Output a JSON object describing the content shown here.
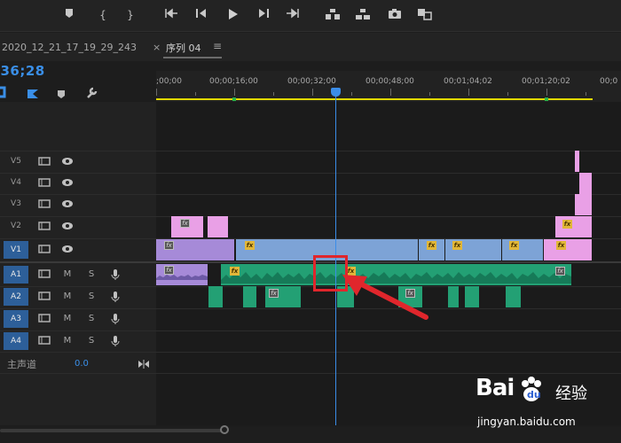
{
  "transport": {
    "buttons": [
      "add-marker",
      "mark-in",
      "mark-out",
      "go-to-in",
      "step-back",
      "play",
      "step-forward",
      "go-to-out",
      "lift",
      "extract",
      "export-frame",
      "comparison-view"
    ]
  },
  "project": {
    "title": "2020_12_21_17_19_29_243"
  },
  "sequence": {
    "close_glyph": "×",
    "tab_label": "序列 04",
    "menu_glyph": "≡"
  },
  "timecode": ";36;28",
  "ruler": {
    "ticks": [
      ";00;00",
      "00;00;16;00",
      "00;00;32;00",
      "00;00;48;00",
      "00;01;04;02",
      "00;01;20;02",
      "00;0"
    ]
  },
  "tracks": {
    "video": [
      "V5",
      "V4",
      "V3",
      "V2",
      "V1"
    ],
    "audio": [
      "A1",
      "A2",
      "A3",
      "A4"
    ],
    "audio_m": "M",
    "audio_s": "S",
    "master_label": "主声道",
    "master_value": "0.0"
  },
  "clips": {
    "fx_label": "fx"
  },
  "colors": {
    "accent": "#3b8de8",
    "annotation": "#e0262c",
    "workarea": "#e0d800",
    "video_clip": "#7da3d6",
    "audio_clip": "#23a074",
    "pink_clip": "#e9a0e6"
  },
  "watermark": {
    "brand": "Bai",
    "brand_cn": "经验",
    "url": "jingyan.baidu.com"
  }
}
